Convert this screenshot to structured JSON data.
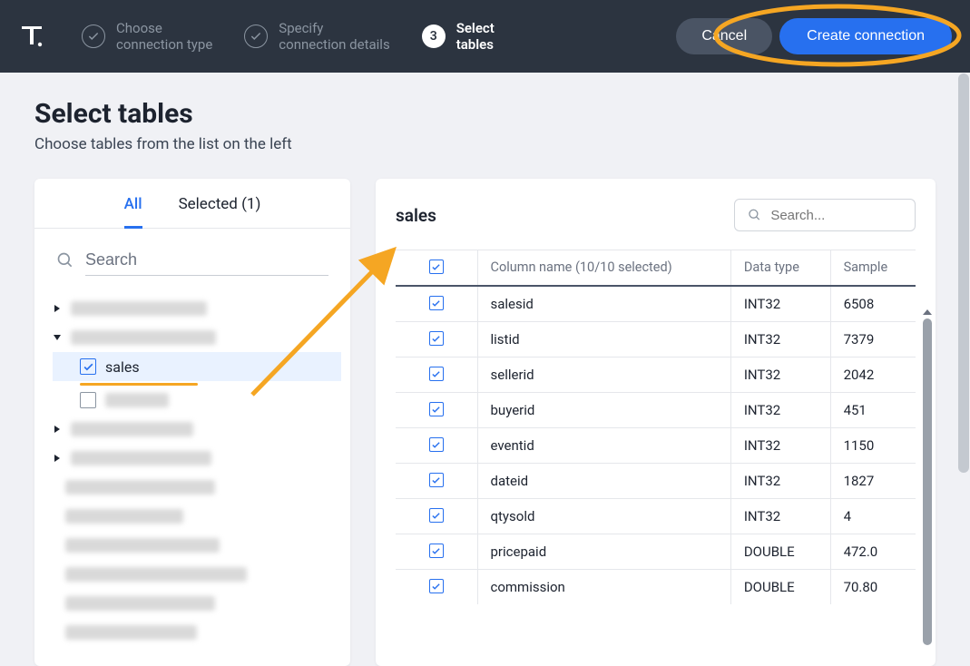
{
  "header": {
    "steps": [
      {
        "label1": "Choose",
        "label2": "connection type",
        "state": "done"
      },
      {
        "label1": "Specify",
        "label2": "connection details",
        "state": "done"
      },
      {
        "num": "3",
        "label1": "Select",
        "label2": "tables",
        "state": "active"
      }
    ],
    "cancel": "Cancel",
    "create": "Create connection"
  },
  "page": {
    "title": "Select tables",
    "subtitle": "Choose tables from the list on the left"
  },
  "left": {
    "tabs": {
      "all": "All",
      "selected": "Selected (1)"
    },
    "search_placeholder": "Search",
    "selected_table": "sales"
  },
  "right": {
    "table_name": "sales",
    "search_placeholder": "Search...",
    "header_col": "Column name (10/10 selected)",
    "header_type": "Data type",
    "header_sample": "Sample",
    "columns": [
      {
        "name": "salesid",
        "type": "INT32",
        "sample": "6508"
      },
      {
        "name": "listid",
        "type": "INT32",
        "sample": "7379"
      },
      {
        "name": "sellerid",
        "type": "INT32",
        "sample": "2042"
      },
      {
        "name": "buyerid",
        "type": "INT32",
        "sample": "451"
      },
      {
        "name": "eventid",
        "type": "INT32",
        "sample": "1150"
      },
      {
        "name": "dateid",
        "type": "INT32",
        "sample": "1827"
      },
      {
        "name": "qtysold",
        "type": "INT32",
        "sample": "4"
      },
      {
        "name": "pricepaid",
        "type": "DOUBLE",
        "sample": "472.0"
      },
      {
        "name": "commission",
        "type": "DOUBLE",
        "sample": "70.80"
      }
    ]
  }
}
